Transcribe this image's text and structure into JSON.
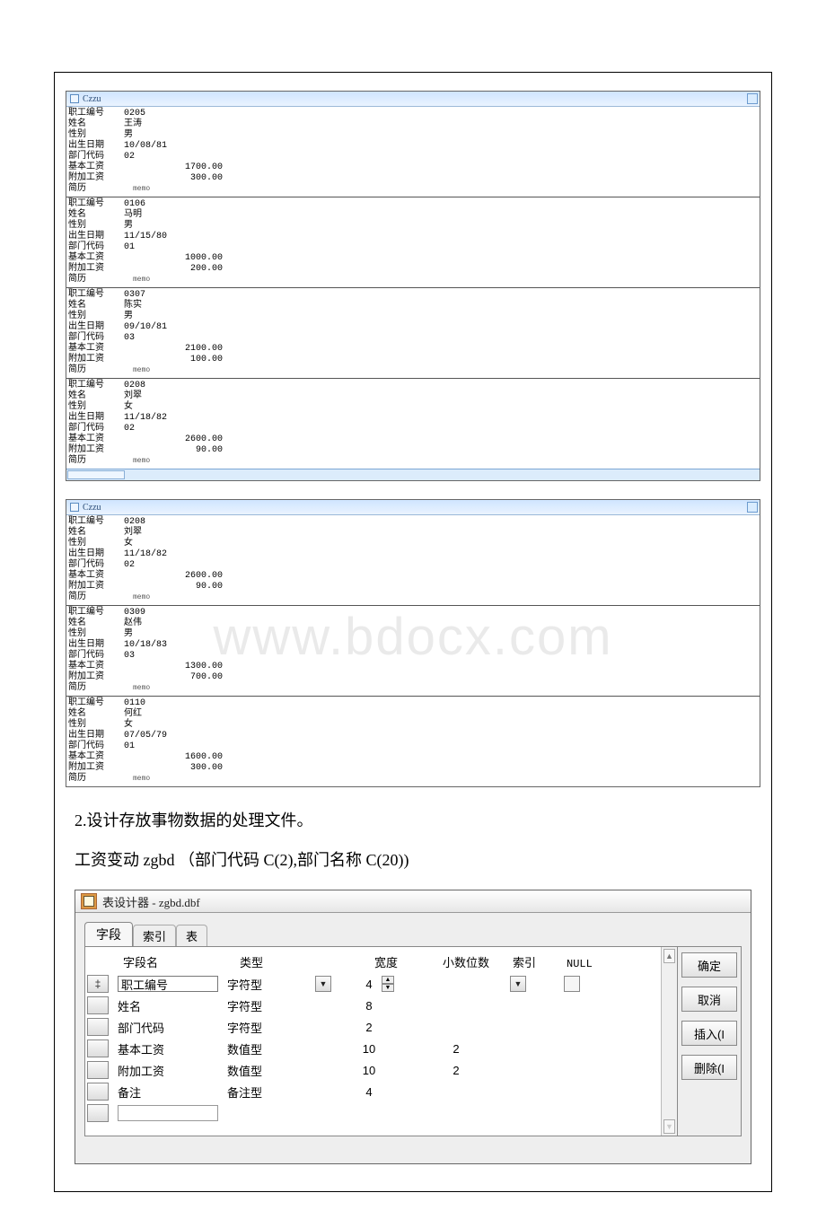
{
  "win1": {
    "title": "Czzu",
    "records": [
      {
        "id": "0205",
        "name": "王涛",
        "sex": "男",
        "birth": "10/08/81",
        "dept": "02",
        "base": "1700.00",
        "extra": "300.00",
        "memo": "memo"
      },
      {
        "id": "0106",
        "name": "马明",
        "sex": "男",
        "birth": "11/15/80",
        "dept": "01",
        "base": "1000.00",
        "extra": "200.00",
        "memo": "memo"
      },
      {
        "id": "0307",
        "name": "陈实",
        "sex": "男",
        "birth": "09/10/81",
        "dept": "03",
        "base": "2100.00",
        "extra": "100.00",
        "memo": "memo"
      },
      {
        "id": "0208",
        "name": "刘翠",
        "sex": "女",
        "birth": "11/18/82",
        "dept": "02",
        "base": "2600.00",
        "extra": "90.00",
        "memo": "memo"
      }
    ]
  },
  "win2": {
    "title": "Czzu",
    "records": [
      {
        "id": "0208",
        "name": "刘翠",
        "sex": "女",
        "birth": "11/18/82",
        "dept": "02",
        "base": "2600.00",
        "extra": "90.00",
        "memo": "memo"
      },
      {
        "id": "0309",
        "name": "赵伟",
        "sex": "男",
        "birth": "10/18/83",
        "dept": "03",
        "base": "1300.00",
        "extra": "700.00",
        "memo": "memo"
      },
      {
        "id": "0110",
        "name": "何红",
        "sex": "女",
        "birth": "07/05/79",
        "dept": "01",
        "base": "1600.00",
        "extra": "300.00",
        "memo": "memo"
      }
    ]
  },
  "labels": {
    "empid": "职工编号",
    "name": "姓名",
    "sex": "性别",
    "birth": "出生日期",
    "dept": "部门代码",
    "base": "基本工资",
    "extra": "附加工资",
    "resume": "简历"
  },
  "watermark": "www.bdocx.com",
  "text": {
    "p1": "2.设计存放事物数据的处理文件。",
    "p2": "工资变动 zgbd （部门代码 C(2),部门名称 C(20))"
  },
  "designer": {
    "title": "表设计器 - zgbd.dbf",
    "tabs": {
      "fields": "字段",
      "index": "索引",
      "table": "表"
    },
    "headers": {
      "name": "字段名",
      "type": "类型",
      "width": "宽度",
      "dec": "小数位数",
      "index": "索引",
      "null": "NULL"
    },
    "rows": [
      {
        "name": "职工编号",
        "type": "字符型",
        "width": "4",
        "dec": "",
        "active": true,
        "showControls": true
      },
      {
        "name": "姓名",
        "type": "字符型",
        "width": "8",
        "dec": ""
      },
      {
        "name": "部门代码",
        "type": "字符型",
        "width": "2",
        "dec": ""
      },
      {
        "name": "基本工资",
        "type": "数值型",
        "width": "10",
        "dec": "2"
      },
      {
        "name": "附加工资",
        "type": "数值型",
        "width": "10",
        "dec": "2"
      },
      {
        "name": "备注",
        "type": "备注型",
        "width": "4",
        "dec": ""
      }
    ],
    "buttons": {
      "ok": "确定",
      "cancel": "取消",
      "insert": "插入(I",
      "delete": "删除(I"
    }
  }
}
